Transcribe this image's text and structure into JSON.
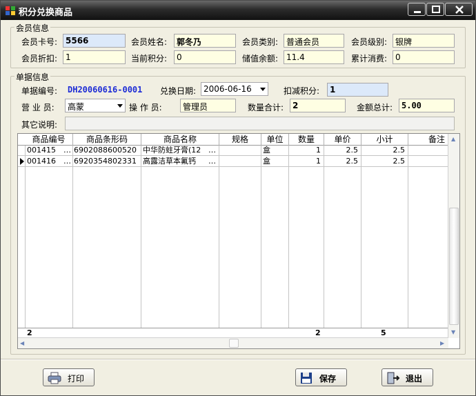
{
  "window": {
    "title": "积分兑换商品"
  },
  "member": {
    "group_title": "会员信息",
    "card_no_label": "会员卡号:",
    "card_no": "5566",
    "name_label": "会员姓名:",
    "name": "郭冬乃",
    "category_label": "会员类别:",
    "category": "普通会员",
    "level_label": "会员级别:",
    "level": "银牌",
    "discount_label": "会员折扣:",
    "discount": "1",
    "points_label": "当前积分:",
    "points": "0",
    "balance_label": "储值余额:",
    "balance": "11.4",
    "total_spend_label": "累计消费:",
    "total_spend": "0"
  },
  "order": {
    "group_title": "单据信息",
    "no_label": "单据编号:",
    "no": "DH20060616-0001",
    "date_label": "兑换日期:",
    "date": "2006-06-16",
    "deduct_label": "扣减积分:",
    "deduct": "1",
    "sales_label": "营 业 员:",
    "sales": "高蒙",
    "operator_label": "操 作 员:",
    "operator": "管理员",
    "qty_total_label": "数量合计:",
    "qty_total": "2",
    "amount_total_label": "金额总计:",
    "amount_total": "5.00",
    "remark_label": "其它说明:",
    "remark": ""
  },
  "grid": {
    "columns": [
      "商品编号",
      "商品条形码",
      "商品名称",
      "规格",
      "单位",
      "数量",
      "单价",
      "小计",
      "备注"
    ],
    "rows": [
      {
        "code": "001415",
        "barcode": "6902088600520",
        "name": "中华防蛀牙膏(12",
        "spec": "",
        "unit": "盒",
        "qty": "1",
        "price": "2.5",
        "subtotal": "2.5",
        "note": ""
      },
      {
        "code": "001416",
        "barcode": "6920354802331",
        "name": "高露洁草本氟钙",
        "spec": "",
        "unit": "盒",
        "qty": "1",
        "price": "2.5",
        "subtotal": "2.5",
        "note": ""
      }
    ],
    "footer": {
      "count": "2",
      "qty": "2",
      "subtotal": "5"
    },
    "ellipsis": "…"
  },
  "buttons": {
    "print": "打印",
    "save": "保存",
    "exit": "退出"
  },
  "colors": {
    "field_yellow": "#fefee3",
    "field_blue": "#dce9fa",
    "order_no": "#1c2bd6",
    "window_bg": "#f1efe2"
  }
}
